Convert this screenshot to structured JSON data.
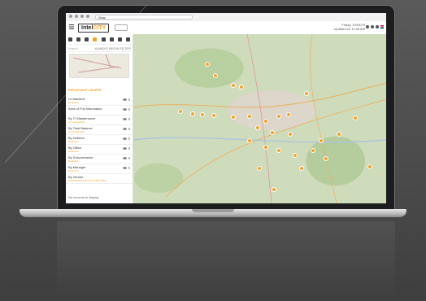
{
  "browser": {
    "url": "/Map"
  },
  "header": {
    "logo_prefix": "Intel",
    "logo_suffix": "CITY",
    "info_line1": "Friday, 10/04/19",
    "info_line2": "Updated on 11:36 AM"
  },
  "sidebar": {
    "search_placeholder": "Search",
    "search_right": "ALWAYS BEGIN FILTER",
    "section_title": "IMPORTANT LAYERS",
    "layers": [
      {
        "name": "Le Machine",
        "sub": "Real-time"
      },
      {
        "name": "Area of Full Information",
        "sub": ""
      },
      {
        "name": "By IT Maintenance",
        "sub": "Unmanageable"
      },
      {
        "name": "By Total Balance",
        "sub": "Unmanageable"
      },
      {
        "name": "By Debtors",
        "sub": "Real-time"
      },
      {
        "name": "By Office",
        "sub": "Real-time"
      },
      {
        "name": "By Subcontractor",
        "sub": "Real-time"
      },
      {
        "name": "By Manager",
        "sub": "Real-time"
      },
      {
        "name": "By Vendor",
        "sub": "IMPORTANT ARTICLE STATUSES"
      }
    ],
    "no_records": "No records to display"
  },
  "colors": {
    "accent": "#f2a12a"
  }
}
